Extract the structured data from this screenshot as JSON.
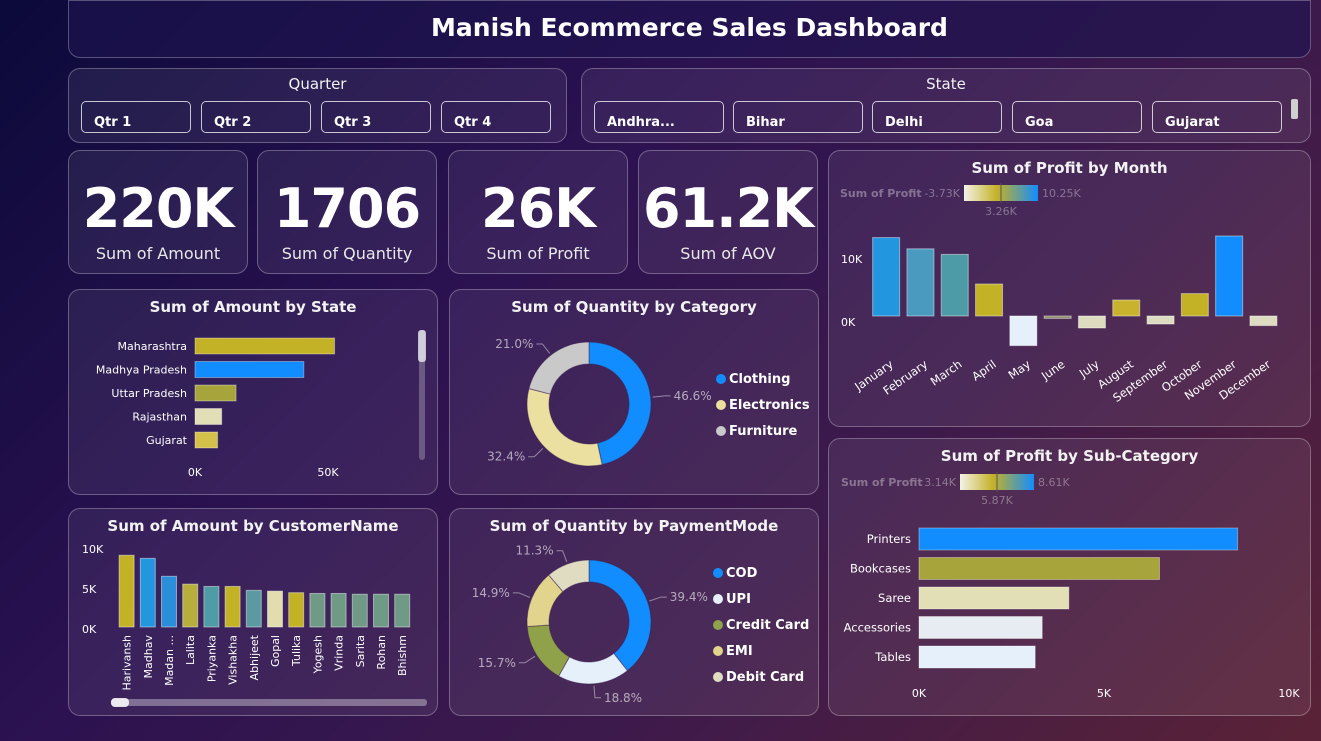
{
  "header": {
    "title": "Manish Ecommerce Sales Dashboard"
  },
  "quarter_slicer": {
    "title": "Quarter",
    "options": [
      "Qtr 1",
      "Qtr 2",
      "Qtr 3",
      "Qtr 4"
    ]
  },
  "state_slicer": {
    "title": "State",
    "options": [
      "Andhra...",
      "Bihar",
      "Delhi",
      "Goa",
      "Gujarat"
    ]
  },
  "kpis": [
    {
      "value": "220K",
      "label": "Sum of Amount"
    },
    {
      "value": "1706",
      "label": "Sum of Quantity"
    },
    {
      "value": "26K",
      "label": "Sum of Profit"
    },
    {
      "value": "61.2K",
      "label": "Sum of AOV"
    }
  ],
  "colors": {
    "blue": "#118dff",
    "gold": "#c3b126",
    "olive": "#a6a43a",
    "cream": "#e2dfb6",
    "pale": "#e6ecf5",
    "teal": "#4a9aa8",
    "grey": "#c9c9c9"
  },
  "chart_data": [
    {
      "id": "amount_by_state",
      "type": "bar",
      "orientation": "horizontal",
      "title": "Sum of Amount by State",
      "categories": [
        "Maharashtra",
        "Madhya Pradesh",
        "Uttar Pradesh",
        "Rajasthan",
        "Gujarat"
      ],
      "values": [
        68000,
        53000,
        20000,
        13000,
        11000
      ],
      "colors": [
        "#c3b126",
        "#118dff",
        "#a6a43a",
        "#e2dfb6",
        "#d4c14a"
      ],
      "xticks": [
        "0K",
        "50K"
      ],
      "xlim": [
        0,
        95000
      ]
    },
    {
      "id": "quantity_by_category",
      "type": "pie",
      "donut": true,
      "title": "Sum of Quantity by Category",
      "labels": [
        "Clothing",
        "Electronics",
        "Furniture"
      ],
      "values": [
        46.6,
        32.4,
        21.0
      ],
      "value_labels": [
        "46.6%",
        "32.4%",
        "21.0%"
      ],
      "colors": [
        "#118dff",
        "#ece0a0",
        "#c9c9c9"
      ]
    },
    {
      "id": "profit_by_month",
      "type": "bar",
      "title": "Sum of Profit by Month",
      "categories": [
        "January",
        "February",
        "March",
        "April",
        "May",
        "June",
        "July",
        "August",
        "September",
        "October",
        "November",
        "December"
      ],
      "values": [
        9800,
        8400,
        7700,
        4000,
        -3700,
        -300,
        -1500,
        2000,
        -1000,
        2800,
        10000,
        -1200
      ],
      "colors": [
        "#2396e0",
        "#4a9ac0",
        "#4d9ba7",
        "#c3b126",
        "#e6f0fb",
        "#8f8c6a",
        "#dedcc0",
        "#c9b22e",
        "#dedcc0",
        "#c3b126",
        "#118dff",
        "#dedcc0"
      ],
      "yticks": [
        "10K",
        "0K"
      ],
      "ylim": [
        -4000,
        11000
      ],
      "color_scale": {
        "label": "Sum of Profit",
        "min": "-3.73K",
        "mid": "3.26K",
        "max": "10.25K"
      }
    },
    {
      "id": "amount_by_customer",
      "type": "bar",
      "title": "Sum of Amount by CustomerName",
      "categories": [
        "Harivansh",
        "Madhav",
        "Madan ...",
        "Lalita",
        "Priyanka",
        "Vishakha",
        "Abhijeet",
        "Gopal",
        "Tulika",
        "Yogesh",
        "Vrinda",
        "Sarita",
        "Rohan",
        "Bhishm"
      ],
      "values": [
        9200,
        8800,
        6500,
        5500,
        5200,
        5200,
        4700,
        4600,
        4400,
        4300,
        4300,
        4200,
        4200,
        4200
      ],
      "colors": [
        "#c3b126",
        "#2396e0",
        "#2a8fd8",
        "#b7ae3c",
        "#4f9ba6",
        "#c3b126",
        "#5a9aa0",
        "#e2dcae",
        "#c3b126",
        "#6f9a86",
        "#6f9a86",
        "#6f9a86",
        "#6f9a86",
        "#6f9a86"
      ],
      "yticks": [
        "10K",
        "5K",
        "0K"
      ],
      "ylim": [
        0,
        10000
      ]
    },
    {
      "id": "quantity_by_paymentmode",
      "type": "pie",
      "donut": true,
      "title": "Sum of Quantity by PaymentMode",
      "labels": [
        "COD",
        "UPI",
        "Credit Card",
        "EMI",
        "Debit Card"
      ],
      "values": [
        39.4,
        18.8,
        15.7,
        14.9,
        11.3
      ],
      "value_labels": [
        "39.4%",
        "18.8%",
        "15.7%",
        "14.9%",
        "11.3%"
      ],
      "colors": [
        "#118dff",
        "#e6f0fb",
        "#8fa24a",
        "#e2d48c",
        "#e0dcc2"
      ]
    },
    {
      "id": "profit_by_subcategory",
      "type": "bar",
      "orientation": "horizontal",
      "title": "Sum of Profit by Sub-Category",
      "categories": [
        "Printers",
        "Bookcases",
        "Saree",
        "Accessories",
        "Tables"
      ],
      "values": [
        8610,
        6500,
        4050,
        3330,
        3140
      ],
      "colors": [
        "#118dff",
        "#a6a43a",
        "#e2dfb6",
        "#e6ecf2",
        "#e6f0fb"
      ],
      "xticks": [
        "0K",
        "5K",
        "10K"
      ],
      "xlim": [
        0,
        10000
      ],
      "color_scale": {
        "label": "Sum of Profit",
        "min": "3.14K",
        "mid": "5.87K",
        "max": "8.61K"
      }
    }
  ]
}
